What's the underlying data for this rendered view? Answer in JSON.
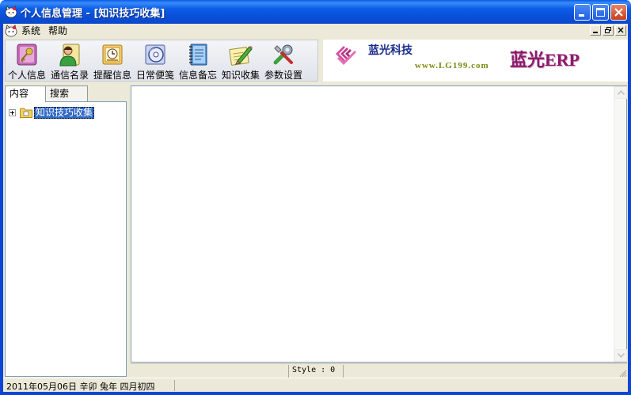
{
  "window": {
    "title": "个人信息管理 - [知识技巧收集]"
  },
  "menu": {
    "items": [
      {
        "label": "系统"
      },
      {
        "label": "帮助"
      }
    ]
  },
  "toolbar": {
    "items": [
      {
        "label": "个人信息",
        "icon": "key-icon"
      },
      {
        "label": "通信名录",
        "icon": "contacts-icon"
      },
      {
        "label": "提醒信息",
        "icon": "clock-icon"
      },
      {
        "label": "日常便笺",
        "icon": "cd-icon"
      },
      {
        "label": "信息备忘",
        "icon": "notebook-icon"
      },
      {
        "label": "知识收集",
        "icon": "pencil-note-icon"
      },
      {
        "label": "参数设置",
        "icon": "tools-icon"
      }
    ]
  },
  "banner": {
    "company": "蓝光科技",
    "url": "www.LG199.com",
    "product": "蓝光ERP"
  },
  "left": {
    "tabs": [
      {
        "label": "内容"
      },
      {
        "label": "搜索"
      }
    ],
    "tree": [
      {
        "label": "知识技巧收集"
      }
    ]
  },
  "editor": {
    "style_label": "Style : 0"
  },
  "status": {
    "date_text": "2011年05月06日  辛卯 兔年  四月初四"
  },
  "colors": {
    "titlebar": "#0a4fd6",
    "selection": "#316ac5",
    "face": "#ece9d8"
  }
}
